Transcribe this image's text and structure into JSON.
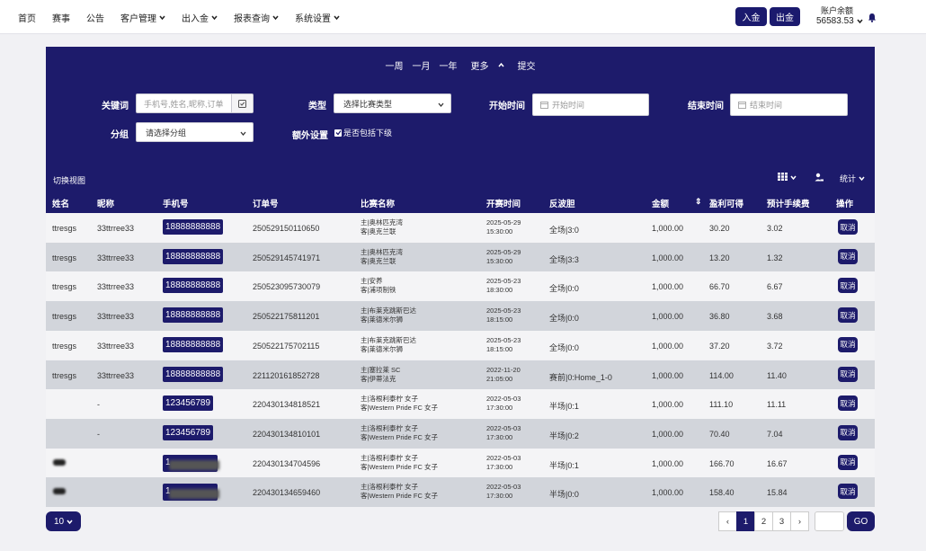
{
  "nav": {
    "items": [
      {
        "label": "首页",
        "dropdown": false
      },
      {
        "label": "赛事",
        "dropdown": false
      },
      {
        "label": "公告",
        "dropdown": false
      },
      {
        "label": "客户管理",
        "dropdown": true
      },
      {
        "label": "出入金",
        "dropdown": true
      },
      {
        "label": "报表查询",
        "dropdown": true
      },
      {
        "label": "系统设置",
        "dropdown": true
      }
    ],
    "deposit_label": "入金",
    "withdraw_label": "出金",
    "balance_label": "账户余额",
    "balance_value": "56583.53"
  },
  "filters": {
    "periods": [
      "一周",
      "一月",
      "一年",
      "更多",
      "提交"
    ],
    "keyword_label": "关键词",
    "keyword_placeholder": "手机号,姓名,昵称,订单",
    "type_label": "类型",
    "type_value": "选择比赛类型",
    "start_label": "开始时间",
    "start_placeholder": "开始时间",
    "end_label": "结束时间",
    "end_placeholder": "结束时间",
    "group_label": "分组",
    "group_value": "请选择分组",
    "extra_label": "额外设置",
    "include_sub_label": "是否包括下级",
    "include_sub_checked": true,
    "switch_view_label": "切换视图",
    "stats_label": "统计"
  },
  "table": {
    "columns": [
      "姓名",
      "昵称",
      "手机号",
      "订单号",
      "比赛名称",
      "开赛时间",
      "反波胆",
      "金额",
      "盈利可得",
      "预计手续费",
      "操作"
    ],
    "rows": [
      {
        "name": "ttresgs",
        "nick": "33ttrree33",
        "phone": "18888888888",
        "order": "250529150110650",
        "home": "主|奥林匹克湾",
        "away": "客|奥克兰联",
        "date": "2025-05-29",
        "time": "15:30:00",
        "bet": "全场|3:0",
        "amount": "1,000.00",
        "profit": "30.20",
        "fee": "3.02",
        "action": "取消"
      },
      {
        "name": "ttresgs",
        "nick": "33ttrree33",
        "phone": "18888888888",
        "order": "250529145741971",
        "home": "主|奥林匹克湾",
        "away": "客|奥克兰联",
        "date": "2025-05-29",
        "time": "15:30:00",
        "bet": "全场|3:3",
        "amount": "1,000.00",
        "profit": "13.20",
        "fee": "1.32",
        "action": "取消"
      },
      {
        "name": "ttresgs",
        "nick": "33ttrree33",
        "phone": "18888888888",
        "order": "250523095730079",
        "home": "主|安养",
        "away": "客|浦项制铁",
        "date": "2025-05-23",
        "time": "18:30:00",
        "bet": "全场|0:0",
        "amount": "1,000.00",
        "profit": "66.70",
        "fee": "6.67",
        "action": "取消"
      },
      {
        "name": "ttresgs",
        "nick": "33ttrree33",
        "phone": "18888888888",
        "order": "250522175811201",
        "home": "主|布莱克跳斯巴达",
        "away": "客|莱德米尔狮",
        "date": "2025-05-23",
        "time": "18:15:00",
        "bet": "全场|0:0",
        "amount": "1,000.00",
        "profit": "36.80",
        "fee": "3.68",
        "action": "取消"
      },
      {
        "name": "ttresgs",
        "nick": "33ttrree33",
        "phone": "18888888888",
        "order": "250522175702115",
        "home": "主|布莱克跳斯巴达",
        "away": "客|莱德米尔狮",
        "date": "2025-05-23",
        "time": "18:15:00",
        "bet": "全场|0:0",
        "amount": "1,000.00",
        "profit": "37.20",
        "fee": "3.72",
        "action": "取消"
      },
      {
        "name": "ttresgs",
        "nick": "33ttrree33",
        "phone": "18888888888",
        "order": "221120161852728",
        "home": "主|塞拉莱 SC",
        "away": "客|伊蒂法克",
        "date": "2022-11-20",
        "time": "21:05:00",
        "bet": "赛前|0:Home_1-0",
        "amount": "1,000.00",
        "profit": "114.00",
        "fee": "11.40",
        "action": "取消"
      },
      {
        "name": "",
        "nick": "-",
        "phone": "123456789",
        "order": "220430134818521",
        "home": "主|洛根利泰柠 女子",
        "away": "客|Western Pride FC 女子",
        "date": "2022-05-03",
        "time": "17:30:00",
        "bet": "半场|0:1",
        "amount": "1,000.00",
        "profit": "111.10",
        "fee": "11.11",
        "action": "取消"
      },
      {
        "name": "",
        "nick": "-",
        "phone": "123456789",
        "order": "220430134810101",
        "home": "主|洛根利泰柠 女子",
        "away": "客|Western Pride FC 女子",
        "date": "2022-05-03",
        "time": "17:30:00",
        "bet": "半场|0:2",
        "amount": "1,000.00",
        "profit": "70.40",
        "fee": "7.04",
        "action": "取消"
      },
      {
        "name": "",
        "nick": "",
        "phone": "1",
        "order": "220430134704596",
        "home": "主|洛根利泰柠 女子",
        "away": "客|Western Pride FC 女子",
        "date": "2022-05-03",
        "time": "17:30:00",
        "bet": "半场|0:1",
        "amount": "1,000.00",
        "profit": "166.70",
        "fee": "16.67",
        "action": "取消"
      },
      {
        "name": "",
        "nick": "",
        "phone": "1",
        "order": "220430134659460",
        "home": "主|洛根利泰柠 女子",
        "away": "客|Western Pride FC 女子",
        "date": "2022-05-03",
        "time": "17:30:00",
        "bet": "半场|0:0",
        "amount": "1,000.00",
        "profit": "158.40",
        "fee": "15.84",
        "action": "取消"
      }
    ]
  },
  "pagination": {
    "page_size": "10",
    "prev": "‹",
    "pages": [
      "1",
      "2",
      "3"
    ],
    "active_page": "1",
    "next": "›",
    "go_label": "GO"
  },
  "colors": {
    "navy": "#1d1b6b",
    "row_even": "#d2d5db",
    "row_odd": "#f4f4f6"
  }
}
